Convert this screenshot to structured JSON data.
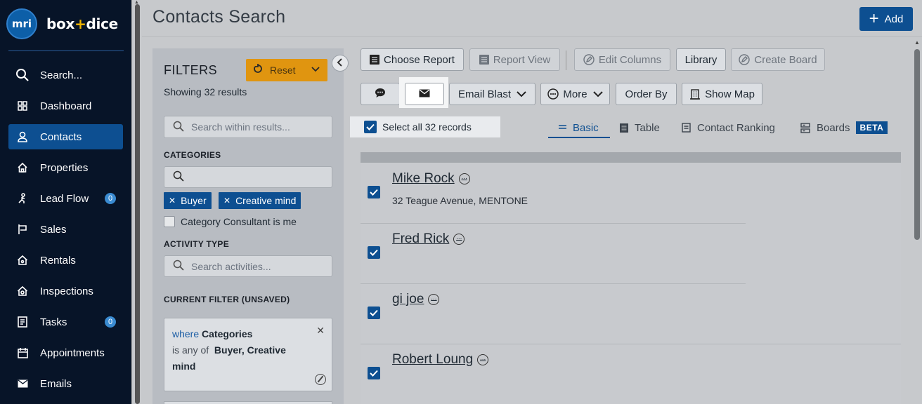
{
  "app": {
    "logo_text": "mri",
    "brand_prefix": "box",
    "brand_plus": "+",
    "brand_suffix": "dice"
  },
  "colors": {
    "sidebar_bg": "#071428",
    "accent": "#0d4f91",
    "reset": "#e09510",
    "brand_plus": "#f1b500"
  },
  "sidebar": {
    "items": [
      {
        "label": "Search...",
        "icon": "search-icon"
      },
      {
        "label": "Dashboard",
        "icon": "dashboard-icon"
      },
      {
        "label": "Contacts",
        "icon": "person-icon",
        "active": true
      },
      {
        "label": "Properties",
        "icon": "home-icon"
      },
      {
        "label": "Lead Flow",
        "icon": "lead-flow-icon",
        "badge": "0"
      },
      {
        "label": "Sales",
        "icon": "sign-icon"
      },
      {
        "label": "Rentals",
        "icon": "house-key-icon"
      },
      {
        "label": "Inspections",
        "icon": "inspection-icon"
      },
      {
        "label": "Tasks",
        "icon": "checklist-icon",
        "badge": "0"
      },
      {
        "label": "Appointments",
        "icon": "calendar-icon"
      },
      {
        "label": "Emails",
        "icon": "envelope-icon"
      }
    ]
  },
  "header": {
    "title": "Contacts Search",
    "add_label": "Add"
  },
  "filters": {
    "title": "FILTERS",
    "reset_label": "Reset",
    "showing": "Showing 32 results",
    "search_placeholder": "Search within results...",
    "categories_label": "CATEGORIES",
    "category_chips": [
      "Buyer",
      "Creative mind"
    ],
    "consultant_label": "Category Consultant is me",
    "activity_label": "ACTIVITY TYPE",
    "activity_placeholder": "Search activities...",
    "current_label": "CURRENT FILTER (UNSAVED)",
    "current": {
      "where": "where",
      "field": "Categories",
      "op": "is any of",
      "values_line1": "Buyer, Creative",
      "values_line2": "mind"
    }
  },
  "toolbar": {
    "choose_report": "Choose Report",
    "report_view": "Report View",
    "edit_columns": "Edit Columns",
    "library": "Library",
    "create_board": "Create Board",
    "email_blast": "Email Blast",
    "more": "More",
    "order_by": "Order By",
    "show_map": "Show Map"
  },
  "select_all": "Select all 32 records",
  "tabs": {
    "basic": "Basic",
    "table": "Table",
    "ranking": "Contact Ranking",
    "boards": "Boards",
    "beta": "BETA"
  },
  "contacts": [
    {
      "name": "Mike Rock",
      "address": "32 Teague Avenue, MENTONE"
    },
    {
      "name": "Fred Rick",
      "address": ""
    },
    {
      "name": "gi joe",
      "address": ""
    },
    {
      "name": "Robert Loung",
      "address": ""
    }
  ]
}
